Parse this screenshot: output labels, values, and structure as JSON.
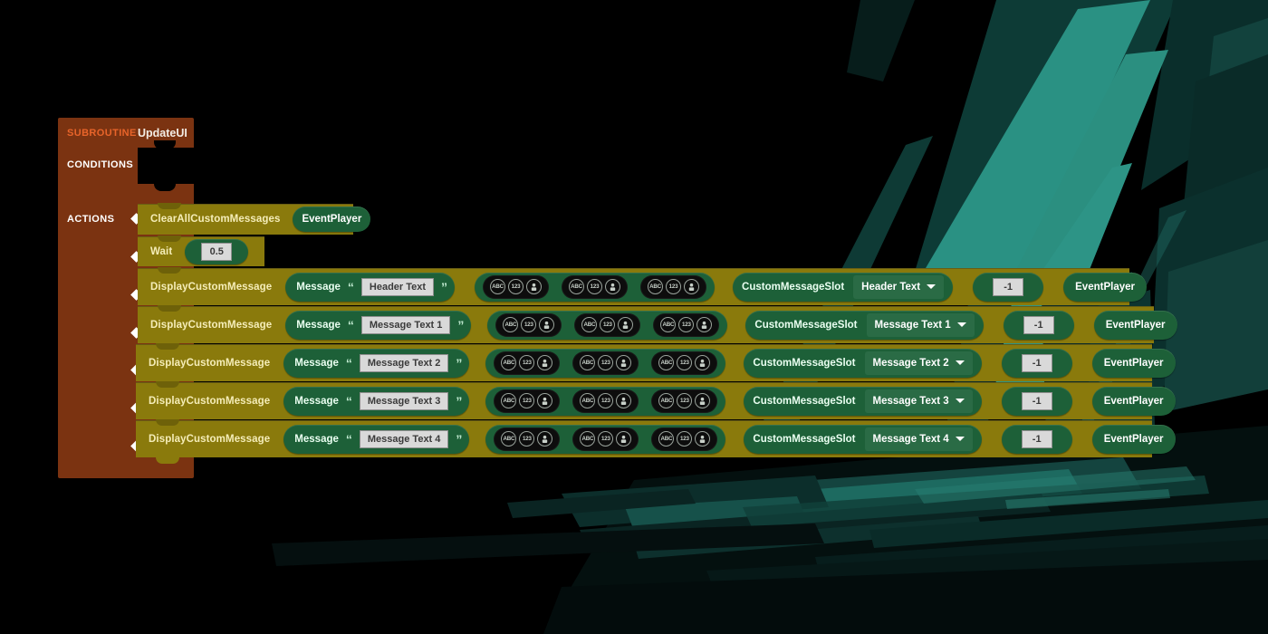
{
  "rule": {
    "kind_label": "SUBROUTINE",
    "name": "UpdateUI",
    "conditions_label": "CONDITIONS",
    "actions_label": "ACTIONS"
  },
  "icons": {
    "chip_abc": "ABC",
    "chip_123": "123",
    "chip_player": "player-icon",
    "caret": "chevron-down-icon",
    "quote_open": "“",
    "quote_close": "”"
  },
  "colors": {
    "rule_brown": "#7b3311",
    "kind_orange": "#e8642a",
    "action_yellow": "#8a7a0c",
    "value_green": "#1d6038",
    "dropdown_green": "#2a6b45",
    "input_gray": "#d9d9d9",
    "background_black": "#000000",
    "background_teal": "#2a8f7e"
  },
  "actions": [
    {
      "name": "ClearAllCustomMessages",
      "type": "simple",
      "player": "EventPlayer"
    },
    {
      "name": "Wait",
      "type": "wait",
      "duration": "0.5"
    },
    {
      "name": "DisplayCustomMessage",
      "type": "message",
      "message_label": "Message",
      "text": "Header Text",
      "slot_label": "CustomMessageSlot",
      "slot_value": "Header Text",
      "sort_order": "-1",
      "player": "EventPlayer",
      "empty_slots": 3
    },
    {
      "name": "DisplayCustomMessage",
      "type": "message",
      "message_label": "Message",
      "text": "Message Text 1",
      "slot_label": "CustomMessageSlot",
      "slot_value": "Message Text 1",
      "sort_order": "-1",
      "player": "EventPlayer",
      "empty_slots": 3
    },
    {
      "name": "DisplayCustomMessage",
      "type": "message",
      "message_label": "Message",
      "text": "Message Text 2",
      "slot_label": "CustomMessageSlot",
      "slot_value": "Message Text 2",
      "sort_order": "-1",
      "player": "EventPlayer",
      "empty_slots": 3
    },
    {
      "name": "DisplayCustomMessage",
      "type": "message",
      "message_label": "Message",
      "text": "Message Text 3",
      "slot_label": "CustomMessageSlot",
      "slot_value": "Message Text 3",
      "sort_order": "-1",
      "player": "EventPlayer",
      "empty_slots": 3
    },
    {
      "name": "DisplayCustomMessage",
      "type": "message",
      "message_label": "Message",
      "text": "Message Text 4",
      "slot_label": "CustomMessageSlot",
      "slot_value": "Message Text 4",
      "sort_order": "-1",
      "player": "EventPlayer",
      "empty_slots": 3
    }
  ]
}
